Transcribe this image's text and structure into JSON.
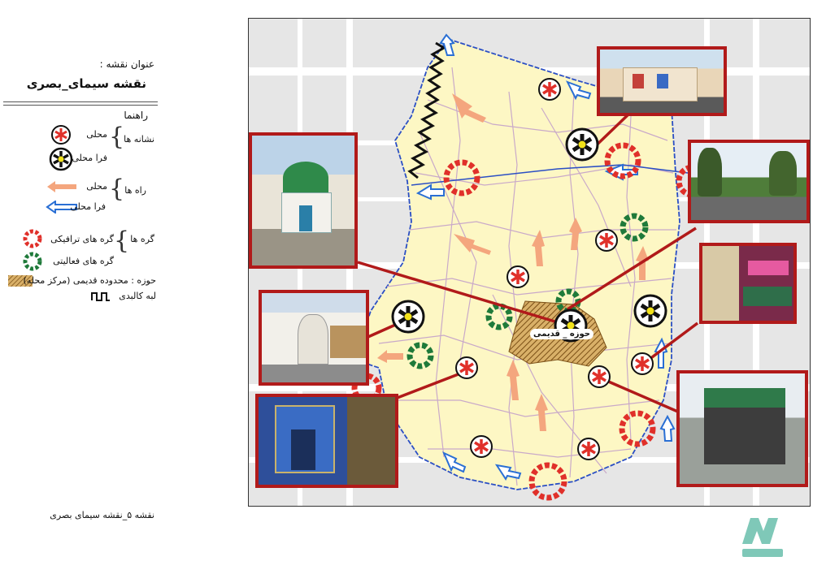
{
  "header": {
    "title_label": "عنوان نقشه :",
    "map_title": "نقشه سیمای_بصری"
  },
  "legend": {
    "heading": "راهنما",
    "groups": [
      {
        "label": "نشانه ها",
        "items": [
          "محلی",
          "فرا محلی"
        ]
      },
      {
        "label": "راه ها",
        "items": [
          "محلی",
          "فرا محلی"
        ]
      },
      {
        "label": "گره ها",
        "items": [
          "گره های ترافیکی",
          "گره های فعالیتی"
        ]
      }
    ],
    "zone_text": "حوزه : محدوده قدیمی (مرکز محله)",
    "edge_text": "لبه کالبدی"
  },
  "map": {
    "zone_label": "حوزه _ قدیمی",
    "colors": {
      "neighborhood_fill": "#fdf7c4",
      "boundary": "#2b4fc4",
      "street": "#c9a9c9",
      "local_path": "#f4a67e",
      "regional_path": "#2a6fd4",
      "traffic_node": "#e0302a",
      "activity_node": "#1f7a3a",
      "connector": "#b11a1a",
      "zone_hatch": "#b8862e"
    }
  },
  "caption": "نقشه ۵_نقشه سیمای بصری"
}
